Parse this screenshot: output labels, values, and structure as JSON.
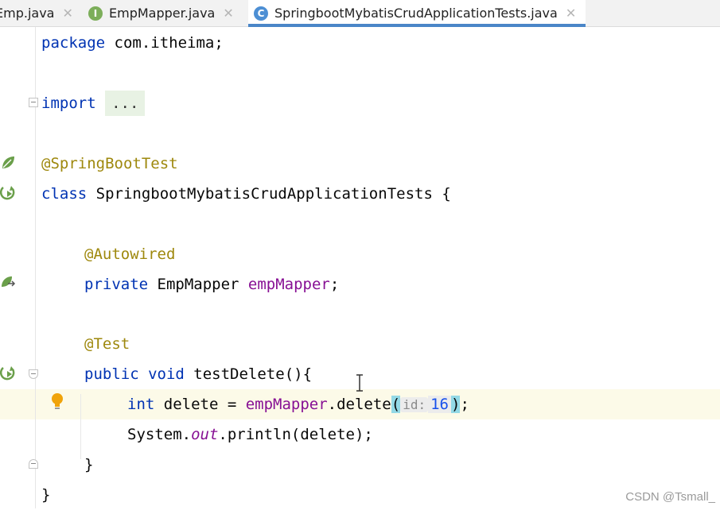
{
  "tabs": [
    {
      "label": "Emp.java",
      "icon": "class-file-icon"
    },
    {
      "label": "EmpMapper.java",
      "icon": "interface-file-icon"
    },
    {
      "label": "SpringbootMybatisCrudApplicationTests.java",
      "icon": "class-file-icon"
    }
  ],
  "active_tab": "SpringbootMybatisCrudApplicationTests.java",
  "code": {
    "l1_kw": "package",
    "l1_rest": " com.itheima;",
    "l2_kw": "import",
    "l2_fold": "...",
    "l3_ann": "@SpringBootTest",
    "l4_kw": "class",
    "l4_rest": " SpringbootMybatisCrudApplicationTests {",
    "l5_ann": "@Autowired",
    "l6_kw": "private",
    "l6_type": " EmpMapper ",
    "l6_field": "empMapper",
    "l6_end": ";",
    "l7_ann": "@Test",
    "l8_kw1": "public",
    "l8_kw2": "void",
    "l8_rest": " testDelete(){",
    "l9_kw": "int",
    "l9_mid": " delete = ",
    "l9_field": "empMapper",
    "l9_call": ".delete",
    "l9_paren_open": "(",
    "l9_hint_label": "id:",
    "l9_hint_value": "16",
    "l9_paren_close": ")",
    "l9_end": ";",
    "l10_a": "System.",
    "l10_field": "out",
    "l10_b": ".println(delete);",
    "l11": "}",
    "l12": "}"
  },
  "watermark": "CSDN @Tsmall_",
  "colors": {
    "keyword": "#0033b3",
    "annotation": "#9e880d",
    "field": "#871094",
    "number": "#1750eb",
    "active_tab_underline": "#4a86c8",
    "spring_icon": "#6a9f4a"
  }
}
